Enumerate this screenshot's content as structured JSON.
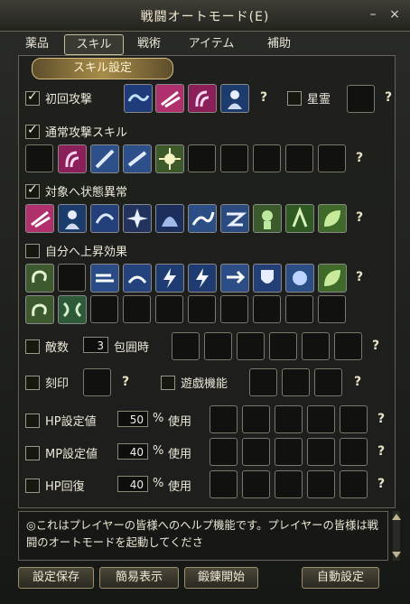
{
  "window": {
    "title": "戦闘オートモード(E)",
    "minimize": "–",
    "close": "×"
  },
  "tabs": [
    "薬品",
    "スキル",
    "戦術",
    "アイテム",
    "補助"
  ],
  "section_header": "スキル設定",
  "first_attack": {
    "label": "初回攻撃",
    "checked": true
  },
  "spirit": {
    "label": "星霊",
    "checked": false
  },
  "normal_skill": {
    "label": "通常攻撃スキル",
    "checked": true
  },
  "target_status": {
    "label": "対象へ状態異常",
    "checked": true
  },
  "self_buff": {
    "label": "自分へ上昇効果",
    "checked": false
  },
  "enemy_count": {
    "label": "敵数",
    "value": "3",
    "suffix": "包囲時",
    "checked": false
  },
  "engrave": {
    "label": "刻印",
    "checked": false
  },
  "play_function": {
    "label": "遊戯機能",
    "checked": false
  },
  "hp_setting": {
    "label": "HP設定値",
    "value": "50",
    "unit": "%",
    "use": "使用",
    "checked": false
  },
  "mp_setting": {
    "label": "MP設定値",
    "value": "40",
    "unit": "%",
    "use": "使用",
    "checked": false
  },
  "hp_recover": {
    "label": "HP回復",
    "value": "40",
    "unit": "%",
    "use": "使用",
    "checked": false
  },
  "question": "?",
  "help_text": "◎これはプレイヤーの皆様へのヘルプ機能です。プレイヤーの皆様は戦闘のオートモードを起動してくださ",
  "buttons": {
    "save": "設定保存",
    "simple": "簡易表示",
    "train": "鍛錬開始",
    "auto": "自動設定"
  },
  "icons": {
    "first_attack": [
      "wave-icon",
      "slash-icon",
      "claw-icon",
      "sage-icon"
    ],
    "normal": [
      "claw-icon",
      "blade-icon",
      "blade-icon",
      "burst-icon"
    ],
    "status": [
      "slash-icon",
      "sage-icon",
      "swirl-icon",
      "star-icon",
      "cloak-icon",
      "splash-icon",
      "wing-icon",
      "hand-icon",
      "figure-icon",
      "leaf-icon",
      "crescent-icon"
    ],
    "buff_row1": [
      "wave-icon",
      "wind-icon",
      "bolt-icon",
      "bolt-icon",
      "run-icon",
      "shield-icon",
      "splash-icon",
      "leaf-icon"
    ],
    "buff_row2": [
      "wave-icon",
      "split-icon"
    ]
  },
  "colors": {
    "accent": "#d6bd7d",
    "panel": "#1e201c"
  }
}
